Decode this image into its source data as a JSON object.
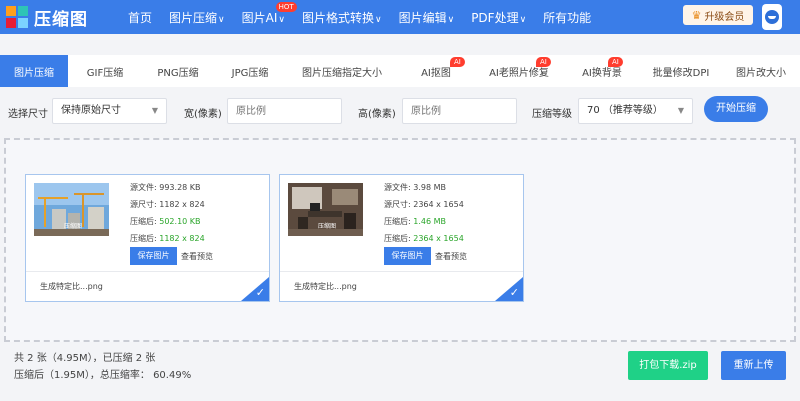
{
  "header": {
    "logo_text": "压缩图",
    "nav": [
      {
        "label": "首页",
        "chevron": false,
        "hot": ""
      },
      {
        "label": "图片压缩",
        "chevron": true,
        "hot": ""
      },
      {
        "label": "图片AI",
        "chevron": true,
        "hot": "HOT"
      },
      {
        "label": "图片格式转换",
        "chevron": true,
        "hot": ""
      },
      {
        "label": "图片编辑",
        "chevron": true,
        "hot": ""
      },
      {
        "label": "PDF处理",
        "chevron": true,
        "hot": ""
      },
      {
        "label": "所有功能",
        "chevron": false,
        "hot": ""
      }
    ],
    "vip_label": "升级会员"
  },
  "tabs": [
    {
      "label": "图片压缩",
      "active": true,
      "badge": ""
    },
    {
      "label": "GIF压缩",
      "active": false,
      "badge": ""
    },
    {
      "label": "PNG压缩",
      "active": false,
      "badge": ""
    },
    {
      "label": "JPG压缩",
      "active": false,
      "badge": ""
    },
    {
      "label": "图片压缩指定大小",
      "active": false,
      "badge": ""
    },
    {
      "label": "AI抠图",
      "active": false,
      "badge": "AI"
    },
    {
      "label": "AI老照片修复",
      "active": false,
      "badge": "AI"
    },
    {
      "label": "AI换背景",
      "active": false,
      "badge": "AI"
    },
    {
      "label": "批量修改DPI",
      "active": false,
      "badge": ""
    },
    {
      "label": "图片改大小",
      "active": false,
      "badge": ""
    }
  ],
  "settings": {
    "size_label": "选择尺寸",
    "size_value": "保持原始尺寸",
    "width_label": "宽(像素)",
    "width_placeholder": "原比例",
    "height_label": "高(像素)",
    "height_placeholder": "原比例",
    "level_label": "压缩等级",
    "level_value": "70 （推荐等级）",
    "start_label": "开始压缩"
  },
  "files": [
    {
      "src_size_label": "源文件: ",
      "src_size": "993.28 KB",
      "src_dim_label": "源尺寸: ",
      "src_dim": "1182 x 824",
      "out_size_label": "压缩后: ",
      "out_size": "502.10 KB",
      "out_dim_label": "压缩后: ",
      "out_dim": "1182 x 824",
      "save_label": "保存图片",
      "preview_label": "查看预览",
      "filename": "生成特定比...png",
      "watermark": "压缩图"
    },
    {
      "src_size_label": "源文件: ",
      "src_size": "3.98 MB",
      "src_dim_label": "源尺寸: ",
      "src_dim": "2364 x 1654",
      "out_size_label": "压缩后: ",
      "out_size": "1.46 MB",
      "out_dim_label": "压缩后: ",
      "out_dim": "2364 x 1654",
      "save_label": "保存图片",
      "preview_label": "查看预览",
      "filename": "生成特定比...png",
      "watermark": "压缩图"
    }
  ],
  "summary": {
    "line1": "共 2 张（4.95M），已压缩 2 张",
    "line2": "压缩后（1.95M），总压缩率： 60.49%"
  },
  "footer": {
    "zip_label": "打包下载.zip",
    "reupload_label": "重新上传"
  },
  "colors": {
    "primary": "#3a7de8",
    "green": "#1fd187",
    "hot": "#ff3d2e"
  },
  "icons": {
    "crown": "♛",
    "check": "✓",
    "chevron": "∨",
    "caret": "▼"
  }
}
